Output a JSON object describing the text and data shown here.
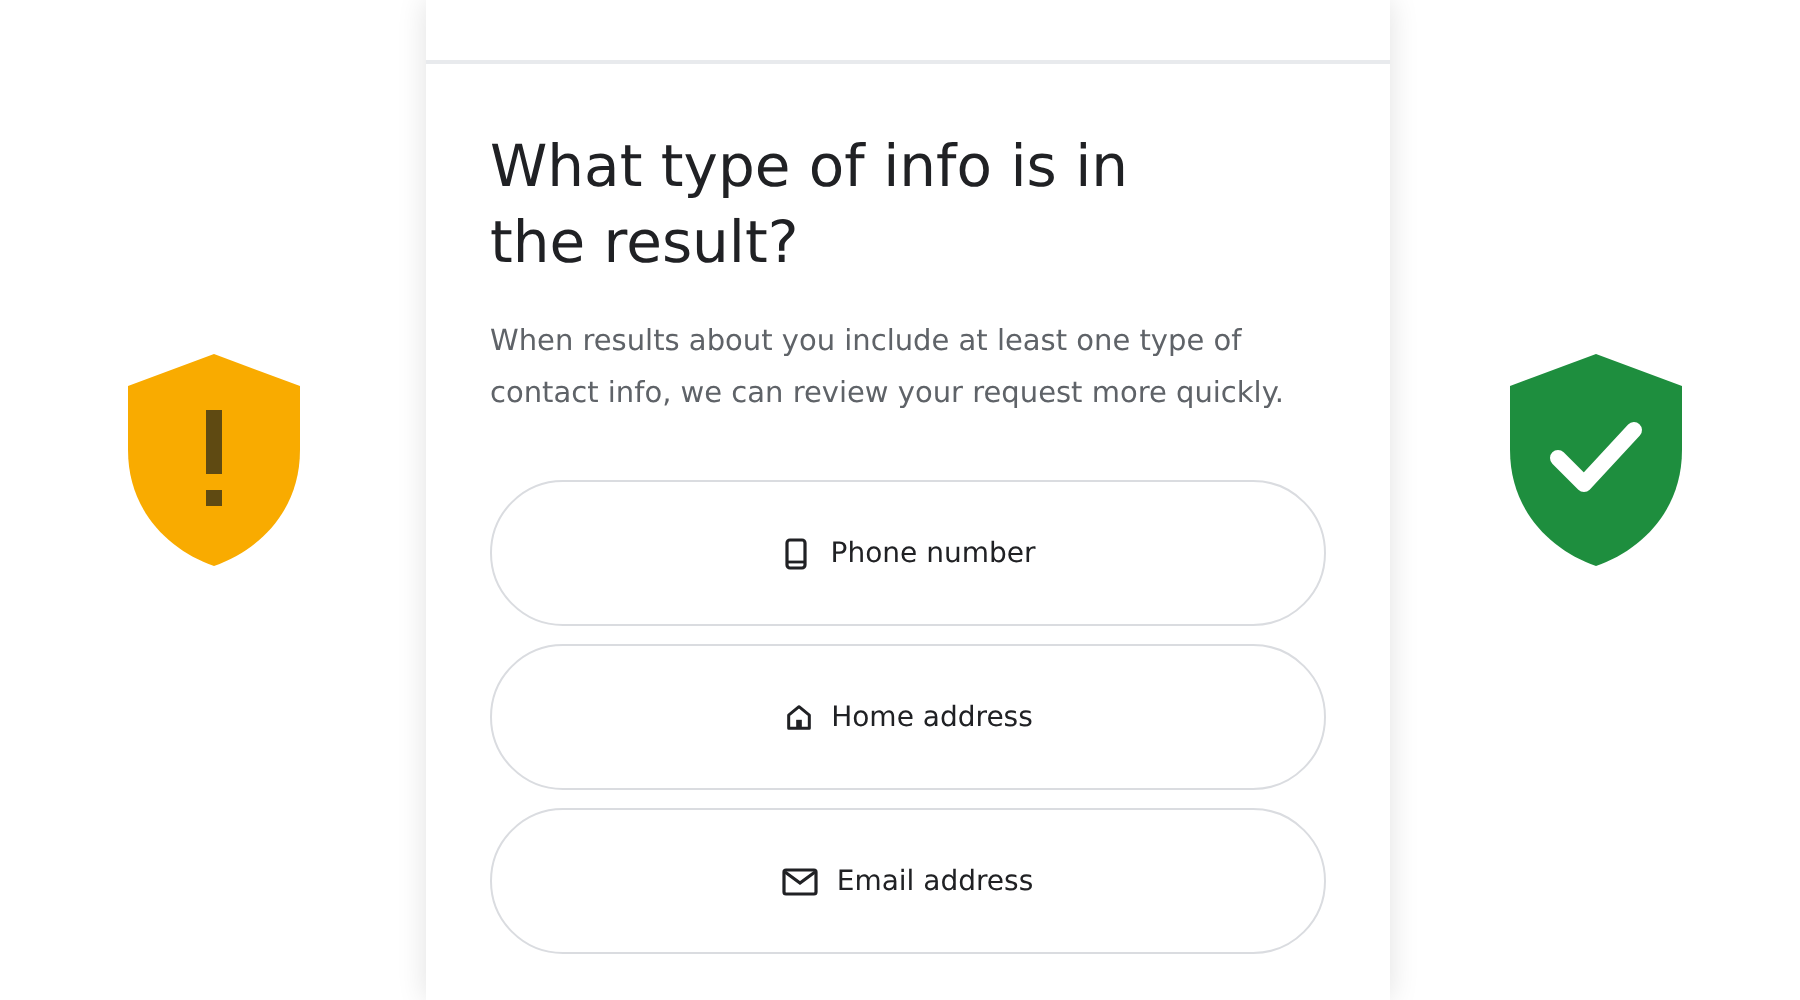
{
  "heading": "What type of info is in the result?",
  "description": "When results about you include at least one type of contact info, we can review your request more quickly.",
  "options": [
    {
      "label": "Phone number",
      "kind": "phone"
    },
    {
      "label": "Home address",
      "kind": "home"
    },
    {
      "label": "Email address",
      "kind": "email"
    }
  ]
}
